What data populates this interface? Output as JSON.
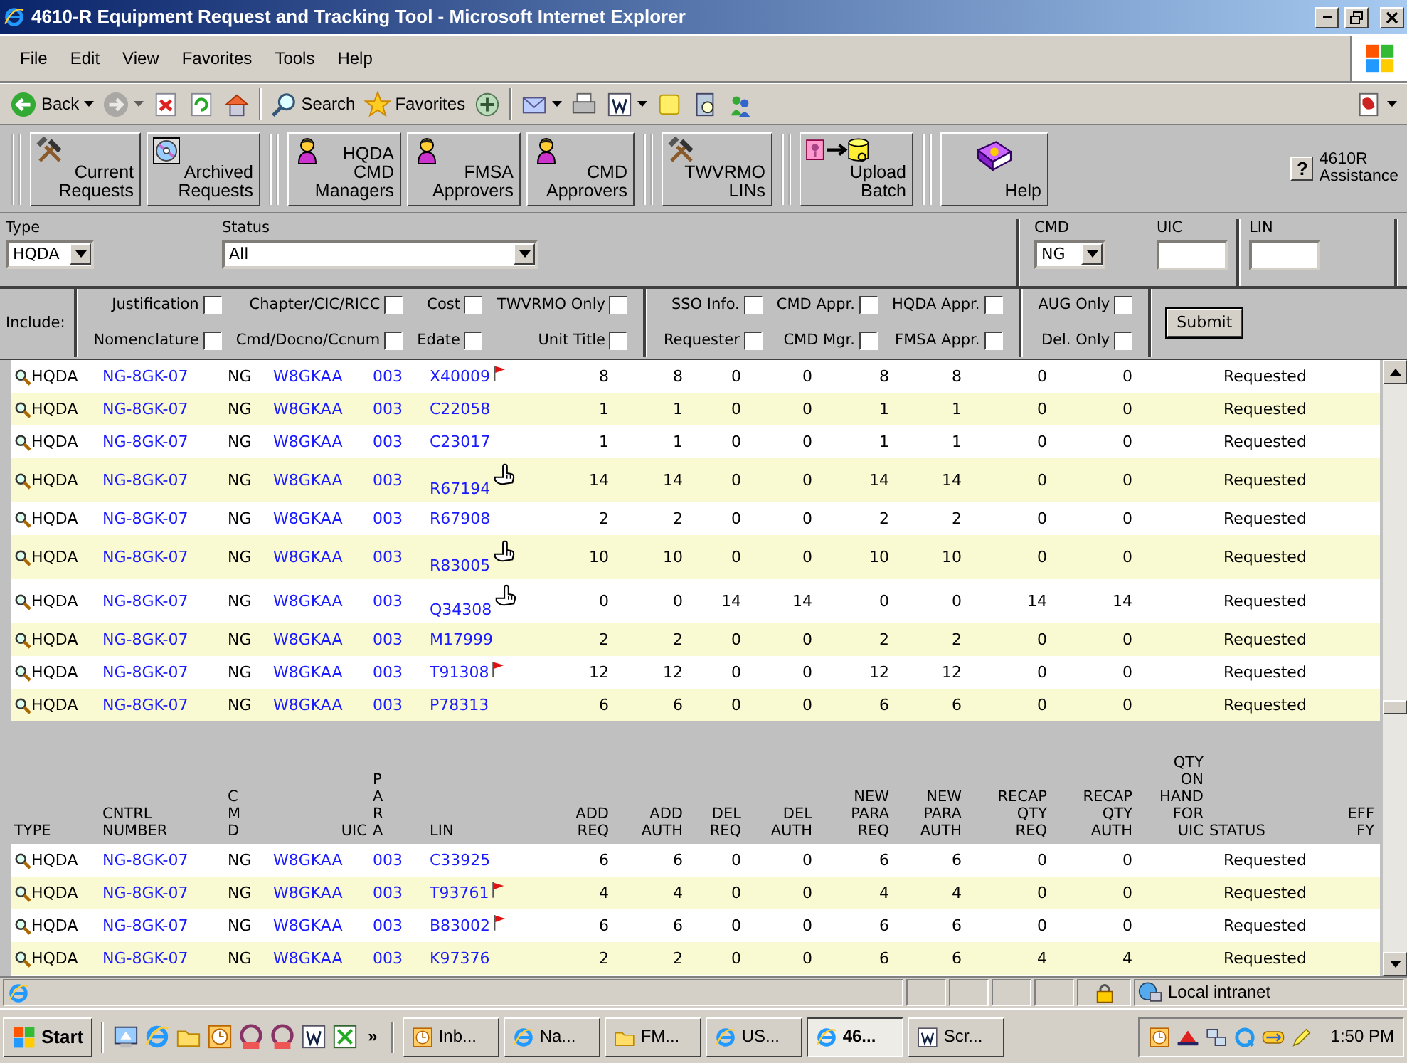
{
  "window": {
    "title": "4610-R Equipment Request and Tracking Tool - Microsoft Internet Explorer"
  },
  "menu": [
    "File",
    "Edit",
    "View",
    "Favorites",
    "Tools",
    "Help"
  ],
  "nav_toolbar": {
    "left": [
      {
        "kind": "back",
        "label": "Back",
        "dropdown": true,
        "disabled": false
      },
      {
        "kind": "forward",
        "dropdown": true,
        "disabled": true
      },
      {
        "kind": "stop",
        "dropdown": false,
        "disabled": false
      },
      {
        "kind": "refresh",
        "dropdown": false,
        "disabled": false
      },
      {
        "kind": "home",
        "dropdown": false,
        "disabled": false
      },
      {
        "kind": "separator"
      },
      {
        "kind": "search",
        "label": "Search",
        "dropdown": false,
        "disabled": false
      },
      {
        "kind": "favorites",
        "label": "Favorites",
        "dropdown": false,
        "disabled": false
      },
      {
        "kind": "media",
        "dropdown": false,
        "disabled": false
      },
      {
        "kind": "separator"
      },
      {
        "kind": "mail",
        "dropdown": true,
        "disabled": false
      },
      {
        "kind": "print",
        "dropdown": false,
        "disabled": false
      },
      {
        "kind": "word",
        "dropdown": true,
        "disabled": false
      },
      {
        "kind": "note",
        "dropdown": false,
        "disabled": false
      },
      {
        "kind": "research",
        "dropdown": false,
        "disabled": false
      },
      {
        "kind": "messenger",
        "dropdown": false,
        "disabled": false
      }
    ],
    "right": [
      {
        "kind": "translate",
        "dropdown": true,
        "disabled": false
      }
    ]
  },
  "app_toolbar": {
    "buttons": [
      {
        "label": "Current Requests",
        "kind": "hammer"
      },
      {
        "label": "Archived Requests",
        "kind": "disk"
      },
      {
        "label": "HQDA CMD Managers",
        "kind": "person"
      },
      {
        "label": "FMSA Approvers",
        "kind": "person"
      },
      {
        "label": "CMD Approvers",
        "kind": "person"
      },
      {
        "label": "TWVRMO LINs",
        "kind": "hammer"
      },
      {
        "label": "Upload Batch",
        "kind": "upload"
      },
      {
        "label": "Help",
        "kind": "book"
      }
    ],
    "assistance": {
      "key": "?",
      "label": "4610R Assistance"
    }
  },
  "filters": {
    "type": {
      "label": "Type",
      "value": "HQDA"
    },
    "status": {
      "label": "Status",
      "value": "All"
    },
    "cmd": {
      "label": "CMD",
      "value": "NG"
    },
    "uic": {
      "label": "UIC"
    },
    "lin": {
      "label": "LIN"
    }
  },
  "include": {
    "label": "Include:",
    "sections": [
      [
        [
          {
            "label": "Justification",
            "checked": false
          },
          {
            "label": "Nomenclature",
            "checked": false
          }
        ],
        [
          {
            "label": "Chapter/CIC/RICC",
            "checked": false
          },
          {
            "label": "Cmd/Docno/Ccnum",
            "checked": false
          }
        ],
        [
          {
            "label": "Cost",
            "checked": false
          },
          {
            "label": "Edate",
            "checked": false
          }
        ],
        [
          {
            "label": "TWVRMO Only",
            "checked": false
          },
          {
            "label": "Unit Title",
            "checked": false
          }
        ]
      ],
      [
        [
          {
            "label": "SSO Info.",
            "checked": false
          },
          {
            "label": "Requester",
            "checked": false
          }
        ],
        [
          {
            "label": "CMD Appr.",
            "checked": false
          },
          {
            "label": "CMD Mgr.",
            "checked": false
          }
        ],
        [
          {
            "label": "HQDA Appr.",
            "checked": false
          },
          {
            "label": "FMSA Appr.",
            "checked": false
          }
        ]
      ],
      [
        [
          {
            "label": "AUG Only",
            "checked": false
          },
          {
            "label": "Del. Only",
            "checked": false
          }
        ]
      ]
    ],
    "submit": "Submit"
  },
  "table": {
    "columns": [
      {
        "label": "TYPE",
        "kind": "words"
      },
      {
        "label": "CNTRL NUMBER",
        "kind": "words"
      },
      {
        "label": "CMD",
        "kind": "letters"
      },
      {
        "label": "UIC",
        "kind": "words"
      },
      {
        "label": "PARA",
        "kind": "letters"
      },
      {
        "label": "LIN",
        "kind": "words"
      },
      {
        "label": "ADD REQ",
        "kind": "words"
      },
      {
        "label": "ADD AUTH",
        "kind": "words"
      },
      {
        "label": "DEL REQ",
        "kind": "words"
      },
      {
        "label": "DEL AUTH",
        "kind": "words"
      },
      {
        "label": "NEW PARA REQ",
        "kind": "words"
      },
      {
        "label": "NEW PARA AUTH",
        "kind": "words"
      },
      {
        "label": "RECAP QTY REQ",
        "kind": "words"
      },
      {
        "label": "RECAP QTY AUTH",
        "kind": "words"
      },
      {
        "label": "QTY ON HAND FOR UIC",
        "kind": "words"
      },
      {
        "label": "STATUS",
        "kind": "words"
      },
      {
        "label": "EFF FY",
        "kind": "words"
      }
    ],
    "rows_above_header": [
      {
        "kind": "flag",
        "type": "HQDA",
        "number": "NG-8GK-07",
        "cmd": "NG",
        "uic": "W8GKAA",
        "para": "003",
        "lin": "X40009",
        "values": [
          "8",
          "8",
          "0",
          "0",
          "8",
          "8",
          "0",
          "0"
        ],
        "status": "Requested"
      },
      {
        "kind": "plain",
        "type": "HQDA",
        "number": "NG-8GK-07",
        "cmd": "NG",
        "uic": "W8GKAA",
        "para": "003",
        "lin": "C22058",
        "values": [
          "1",
          "1",
          "0",
          "0",
          "1",
          "1",
          "0",
          "0"
        ],
        "status": "Requested"
      },
      {
        "kind": "plain",
        "type": "HQDA",
        "number": "NG-8GK-07",
        "cmd": "NG",
        "uic": "W8GKAA",
        "para": "003",
        "lin": "C23017",
        "values": [
          "1",
          "1",
          "0",
          "0",
          "1",
          "1",
          "0",
          "0"
        ],
        "status": "Requested"
      },
      {
        "kind": "hand",
        "type": "HQDA",
        "number": "NG-8GK-07",
        "cmd": "NG",
        "uic": "W8GKAA",
        "para": "003",
        "lin": "R67194",
        "values": [
          "14",
          "14",
          "0",
          "0",
          "14",
          "14",
          "0",
          "0"
        ],
        "status": "Requested"
      },
      {
        "kind": "plain",
        "type": "HQDA",
        "number": "NG-8GK-07",
        "cmd": "NG",
        "uic": "W8GKAA",
        "para": "003",
        "lin": "R67908",
        "values": [
          "2",
          "2",
          "0",
          "0",
          "2",
          "2",
          "0",
          "0"
        ],
        "status": "Requested"
      },
      {
        "kind": "hand",
        "type": "HQDA",
        "number": "NG-8GK-07",
        "cmd": "NG",
        "uic": "W8GKAA",
        "para": "003",
        "lin": "R83005",
        "values": [
          "10",
          "10",
          "0",
          "0",
          "10",
          "10",
          "0",
          "0"
        ],
        "status": "Requested"
      },
      {
        "kind": "hand",
        "type": "HQDA",
        "number": "NG-8GK-07",
        "cmd": "NG",
        "uic": "W8GKAA",
        "para": "003",
        "lin": "Q34308",
        "values": [
          "0",
          "0",
          "14",
          "14",
          "0",
          "0",
          "14",
          "14"
        ],
        "status": "Requested"
      },
      {
        "kind": "plain",
        "type": "HQDA",
        "number": "NG-8GK-07",
        "cmd": "NG",
        "uic": "W8GKAA",
        "para": "003",
        "lin": "M17999",
        "values": [
          "2",
          "2",
          "0",
          "0",
          "2",
          "2",
          "0",
          "0"
        ],
        "status": "Requested"
      },
      {
        "kind": "flag",
        "type": "HQDA",
        "number": "NG-8GK-07",
        "cmd": "NG",
        "uic": "W8GKAA",
        "para": "003",
        "lin": "T91308",
        "values": [
          "12",
          "12",
          "0",
          "0",
          "12",
          "12",
          "0",
          "0"
        ],
        "status": "Requested"
      },
      {
        "kind": "plain",
        "type": "HQDA",
        "number": "NG-8GK-07",
        "cmd": "NG",
        "uic": "W8GKAA",
        "para": "003",
        "lin": "P78313",
        "values": [
          "6",
          "6",
          "0",
          "0",
          "6",
          "6",
          "0",
          "0"
        ],
        "status": "Requested"
      }
    ],
    "rows_below_header": [
      {
        "kind": "plain",
        "type": "HQDA",
        "number": "NG-8GK-07",
        "cmd": "NG",
        "uic": "W8GKAA",
        "para": "003",
        "lin": "C33925",
        "values": [
          "6",
          "6",
          "0",
          "0",
          "6",
          "6",
          "0",
          "0"
        ],
        "status": "Requested"
      },
      {
        "kind": "flag",
        "type": "HQDA",
        "number": "NG-8GK-07",
        "cmd": "NG",
        "uic": "W8GKAA",
        "para": "003",
        "lin": "T93761",
        "values": [
          "4",
          "4",
          "0",
          "0",
          "4",
          "4",
          "0",
          "0"
        ],
        "status": "Requested"
      },
      {
        "kind": "flag",
        "type": "HQDA",
        "number": "NG-8GK-07",
        "cmd": "NG",
        "uic": "W8GKAA",
        "para": "003",
        "lin": "B83002",
        "values": [
          "6",
          "6",
          "0",
          "0",
          "6",
          "6",
          "0",
          "0"
        ],
        "status": "Requested"
      },
      {
        "kind": "plain",
        "type": "HQDA",
        "number": "NG-8GK-07",
        "cmd": "NG",
        "uic": "W8GKAA",
        "para": "003",
        "lin": "K97376",
        "values": [
          "2",
          "2",
          "0",
          "0",
          "6",
          "6",
          "4",
          "4"
        ],
        "status": "Requested"
      }
    ]
  },
  "status_bar": {
    "zone": "Local intranet"
  },
  "taskbar": {
    "start": "Start",
    "quick_launch": [
      {
        "kind": "desktop"
      },
      {
        "kind": "ie"
      },
      {
        "kind": "folder"
      },
      {
        "kind": "clock"
      },
      {
        "kind": "ring"
      },
      {
        "kind": "ring"
      },
      {
        "kind": "word"
      },
      {
        "kind": "excel"
      }
    ],
    "more": "»",
    "tasks": [
      {
        "label": "Inb...",
        "kind": "clock",
        "selected": false
      },
      {
        "label": "Na...",
        "kind": "ie",
        "selected": false
      },
      {
        "label": "FM...",
        "kind": "folder",
        "selected": false
      },
      {
        "label": "US...",
        "kind": "ie",
        "selected": false
      },
      {
        "label": "46...",
        "kind": "ie",
        "selected": true
      },
      {
        "label": "Scr...",
        "kind": "word",
        "selected": false
      }
    ],
    "tray": [
      {
        "kind": "clock"
      },
      {
        "kind": "hat"
      },
      {
        "kind": "network"
      },
      {
        "kind": "qcircle"
      },
      {
        "kind": "arrows"
      },
      {
        "kind": "pencil"
      }
    ],
    "time": "1:50 PM"
  }
}
